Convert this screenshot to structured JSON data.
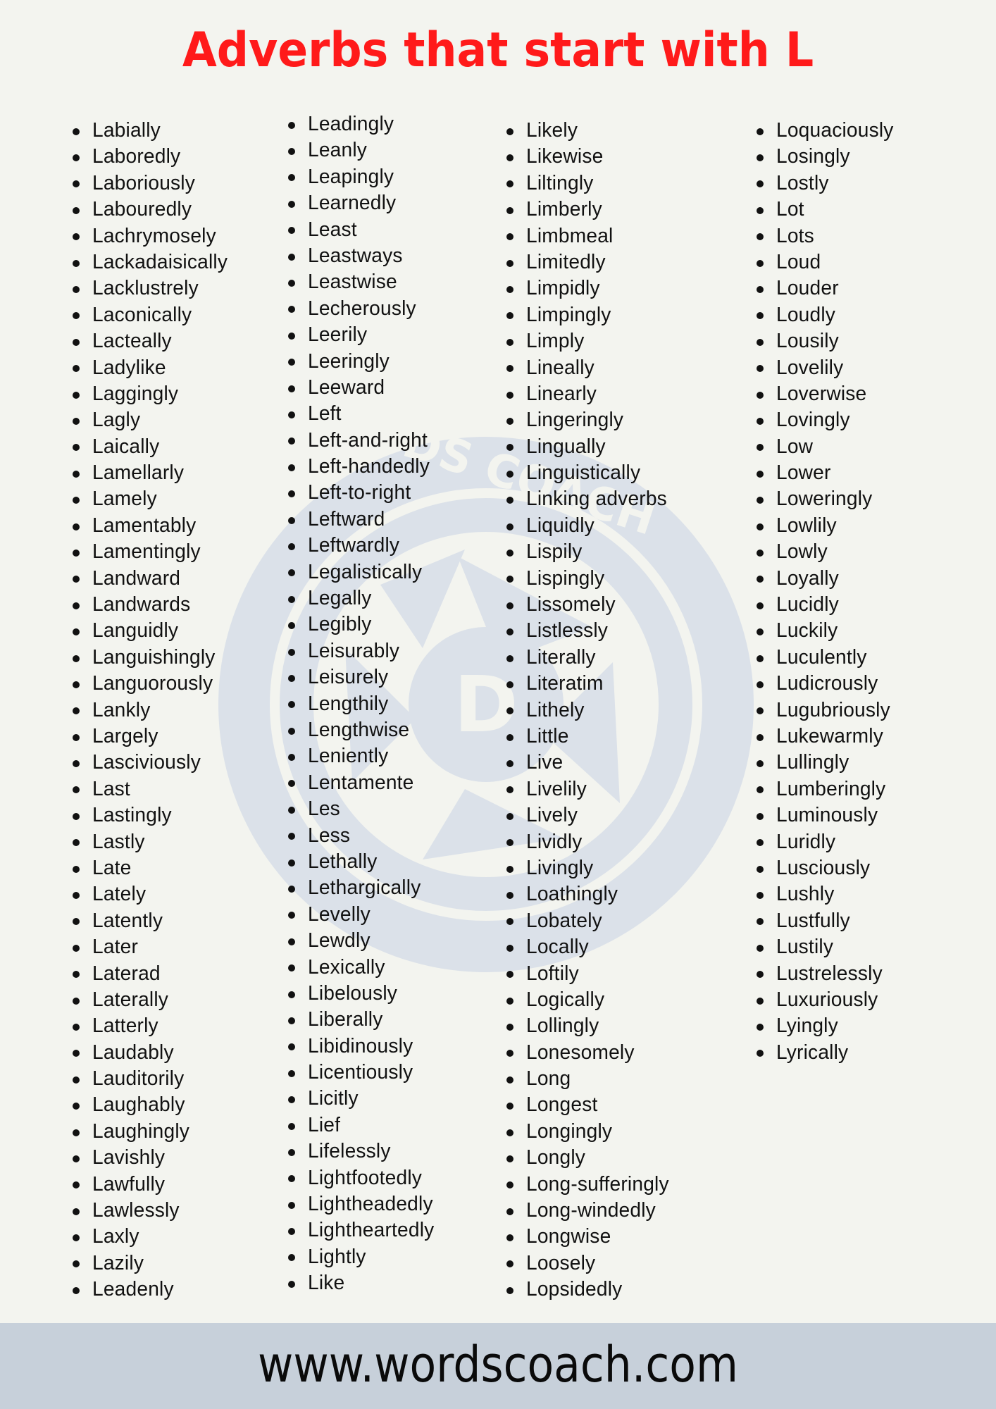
{
  "title": "Adverbs that start with L",
  "colors": {
    "title": "#ff1a1a",
    "background": "#f3f4ef",
    "footer_band": "#c7d0da",
    "watermark": "#dbe1e9",
    "text": "#111111"
  },
  "watermark": {
    "icon": "wordscoach-camera-aperture-logo",
    "text": "WORDS COACH",
    "letter": "D"
  },
  "columns": [
    {
      "items": [
        "Labially",
        "Laboredly",
        "Laboriously",
        "Labouredly",
        "Lachrymosely",
        "Lackadaisically",
        "Lacklustrely",
        "Laconically",
        "Lacteally",
        "Ladylike",
        "Laggingly",
        "Lagly",
        "Laically",
        "Lamellarly",
        "Lamely",
        "Lamentably",
        "Lamentingly",
        "Landward",
        "Landwards",
        "Languidly",
        "Languishingly",
        "Languorously",
        "Lankly",
        "Largely",
        "Lasciviously",
        "Last",
        "Lastingly",
        "Lastly",
        "Late",
        "Lately",
        "Latently",
        "Later",
        "Laterad",
        "Laterally",
        "Latterly",
        "Laudably",
        "Lauditorily",
        "Laughably",
        "Laughingly",
        "Lavishly",
        "Lawfully",
        "Lawlessly",
        "Laxly",
        "Lazily",
        "Leadenly"
      ]
    },
    {
      "items": [
        "Leadingly",
        "Leanly",
        "Leapingly",
        "Learnedly",
        "Least",
        "Leastways",
        "Leastwise",
        "Lecherously",
        "Leerily",
        "Leeringly",
        "Leeward",
        "Left",
        "Left-and-right",
        "Left-handedly",
        "Left-to-right",
        "Leftward",
        "Leftwardly",
        "Legalistically",
        "Legally",
        "Legibly",
        "Leisurably",
        "Leisurely",
        "Lengthily",
        "Lengthwise",
        "Leniently",
        "Lentamente",
        "Les",
        "Less",
        "Lethally",
        "Lethargically",
        "Levelly",
        "Lewdly",
        "Lexically",
        "Libelously",
        "Liberally",
        "Libidinously",
        "Licentiously",
        "Licitly",
        "Lief",
        "Lifelessly",
        "Lightfootedly",
        "Lightheadedly",
        "Lightheartedly",
        "Lightly",
        "Like"
      ]
    },
    {
      "items": [
        "Likely",
        "Likewise",
        "Liltingly",
        "Limberly",
        "Limbmeal",
        "Limitedly",
        "Limpidly",
        "Limpingly",
        "Limply",
        "Lineally",
        "Linearly",
        "Lingeringly",
        "Lingually",
        "Linguistically",
        "Linking adverbs",
        "Liquidly",
        "Lispily",
        "Lispingly",
        "Lissomely",
        "Listlessly",
        "Literally",
        "Literatim",
        "Lithely",
        "Little",
        "Live",
        "Livelily",
        "Lively",
        "Lividly",
        "Livingly",
        "Loathingly",
        "Lobately",
        "Locally",
        "Loftily",
        "Logically",
        "Lollingly",
        "Lonesomely",
        "Long",
        "Longest",
        "Longingly",
        "Longly",
        "Long-sufferingly",
        "Long-windedly",
        "Longwise",
        "Loosely",
        "Lopsidedly"
      ]
    },
    {
      "items": [
        "Loquaciously",
        "Losingly",
        "Lostly",
        "Lot",
        "Lots",
        "Loud",
        "Louder",
        "Loudly",
        "Lousily",
        "Lovelily",
        "Loverwise",
        "Lovingly",
        "Low",
        "Lower",
        "Loweringly",
        "Lowlily",
        "Lowly",
        "Loyally",
        "Lucidly",
        "Luckily",
        "Luculently",
        "Ludicrously",
        "Lugubriously",
        "Lukewarmly",
        "Lullingly",
        "Lumberingly",
        "Luminously",
        "Luridly",
        "Lusciously",
        "Lushly",
        "Lustfully",
        "Lustily",
        "Lustrelessly",
        "Luxuriously",
        "Lyingly",
        "Lyrically"
      ]
    }
  ],
  "footer": {
    "url": "www.wordscoach.com"
  }
}
